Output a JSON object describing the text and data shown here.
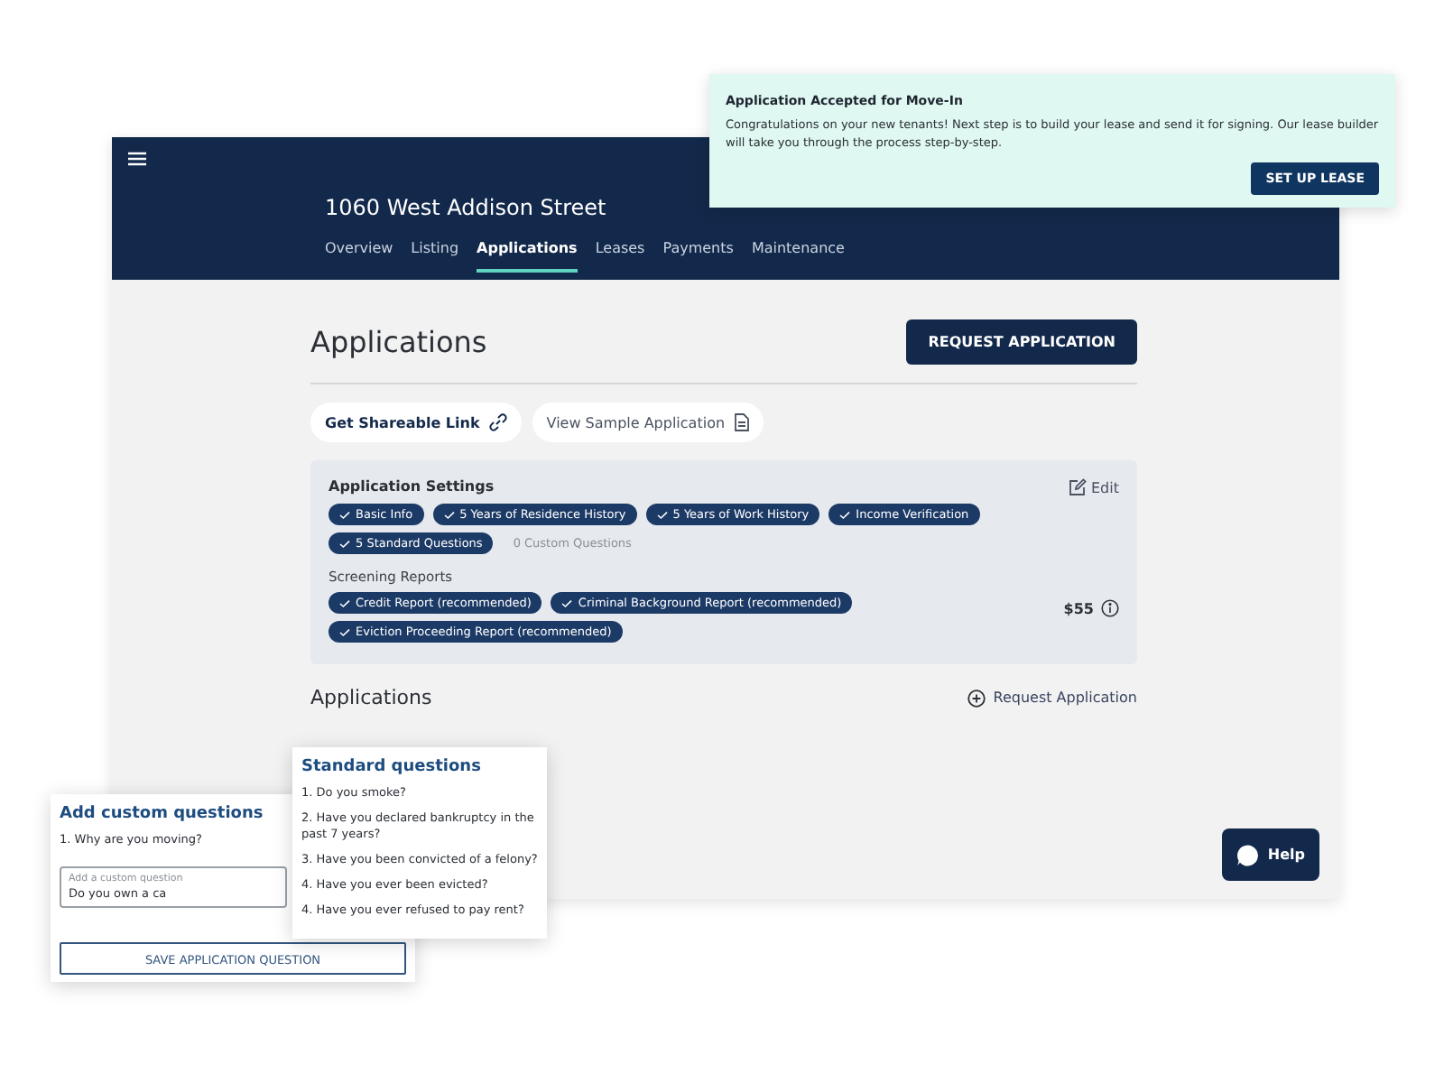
{
  "property": {
    "title": "1060 West Addison Street"
  },
  "tabs": [
    {
      "label": "Overview",
      "selected": false
    },
    {
      "label": "Listing",
      "selected": false
    },
    {
      "label": "Applications",
      "selected": true
    },
    {
      "label": "Leases",
      "selected": false
    },
    {
      "label": "Payments",
      "selected": false
    },
    {
      "label": "Maintenance",
      "selected": false
    }
  ],
  "page": {
    "title": "Applications",
    "primary_button": "REQUEST APPLICATION",
    "links": [
      {
        "label": "Get Shareable Link",
        "kind": "link"
      },
      {
        "label": "View Sample Application",
        "kind": "document"
      }
    ]
  },
  "settings": {
    "title": "Application Settings",
    "edit": "Edit",
    "tags": [
      {
        "label": "Basic Info",
        "checked": true
      },
      {
        "label": "5 Years of Residence History",
        "checked": true
      },
      {
        "label": "5 Years of Work History",
        "checked": true
      },
      {
        "label": "Income Verification",
        "checked": true
      },
      {
        "label": "5 Standard Questions",
        "checked": true
      },
      {
        "label": "0 Custom Questions",
        "checked": false
      }
    ],
    "screening_title": "Screening Reports",
    "reports": [
      {
        "label": "Credit Report (recommended)",
        "checked": true
      },
      {
        "label": "Criminal Background Report (recommended)",
        "checked": true
      },
      {
        "label": "Eviction Proceeding Report (recommended)",
        "checked": true
      }
    ],
    "price": "$55"
  },
  "applications": {
    "title": "Applications",
    "action": "Request Application"
  },
  "help": "Help",
  "notification": {
    "title": "Application Accepted for Move-In",
    "message": "Congratulations on your new tenants! Next step is to build your lease and send it for signing. Our lease builder will take you through the process step-by-step.",
    "button": "SET UP LEASE"
  },
  "standard_questions": {
    "title": "Standard questions",
    "items": [
      "1. Do you smoke?",
      "2. Have you declared bankruptcy in the past 7 years?",
      "3. Have you been convicted of a felony?",
      "4. Have you ever been evicted?",
      "4. Have you ever refused to pay rent?"
    ]
  },
  "custom_questions": {
    "title": "Add custom questions",
    "items": [
      "1. Why are you moving?"
    ],
    "field": {
      "label": "Add a custom question",
      "value": "Do you own a ca"
    },
    "button": "SAVE APPLICATION QUESTION"
  }
}
